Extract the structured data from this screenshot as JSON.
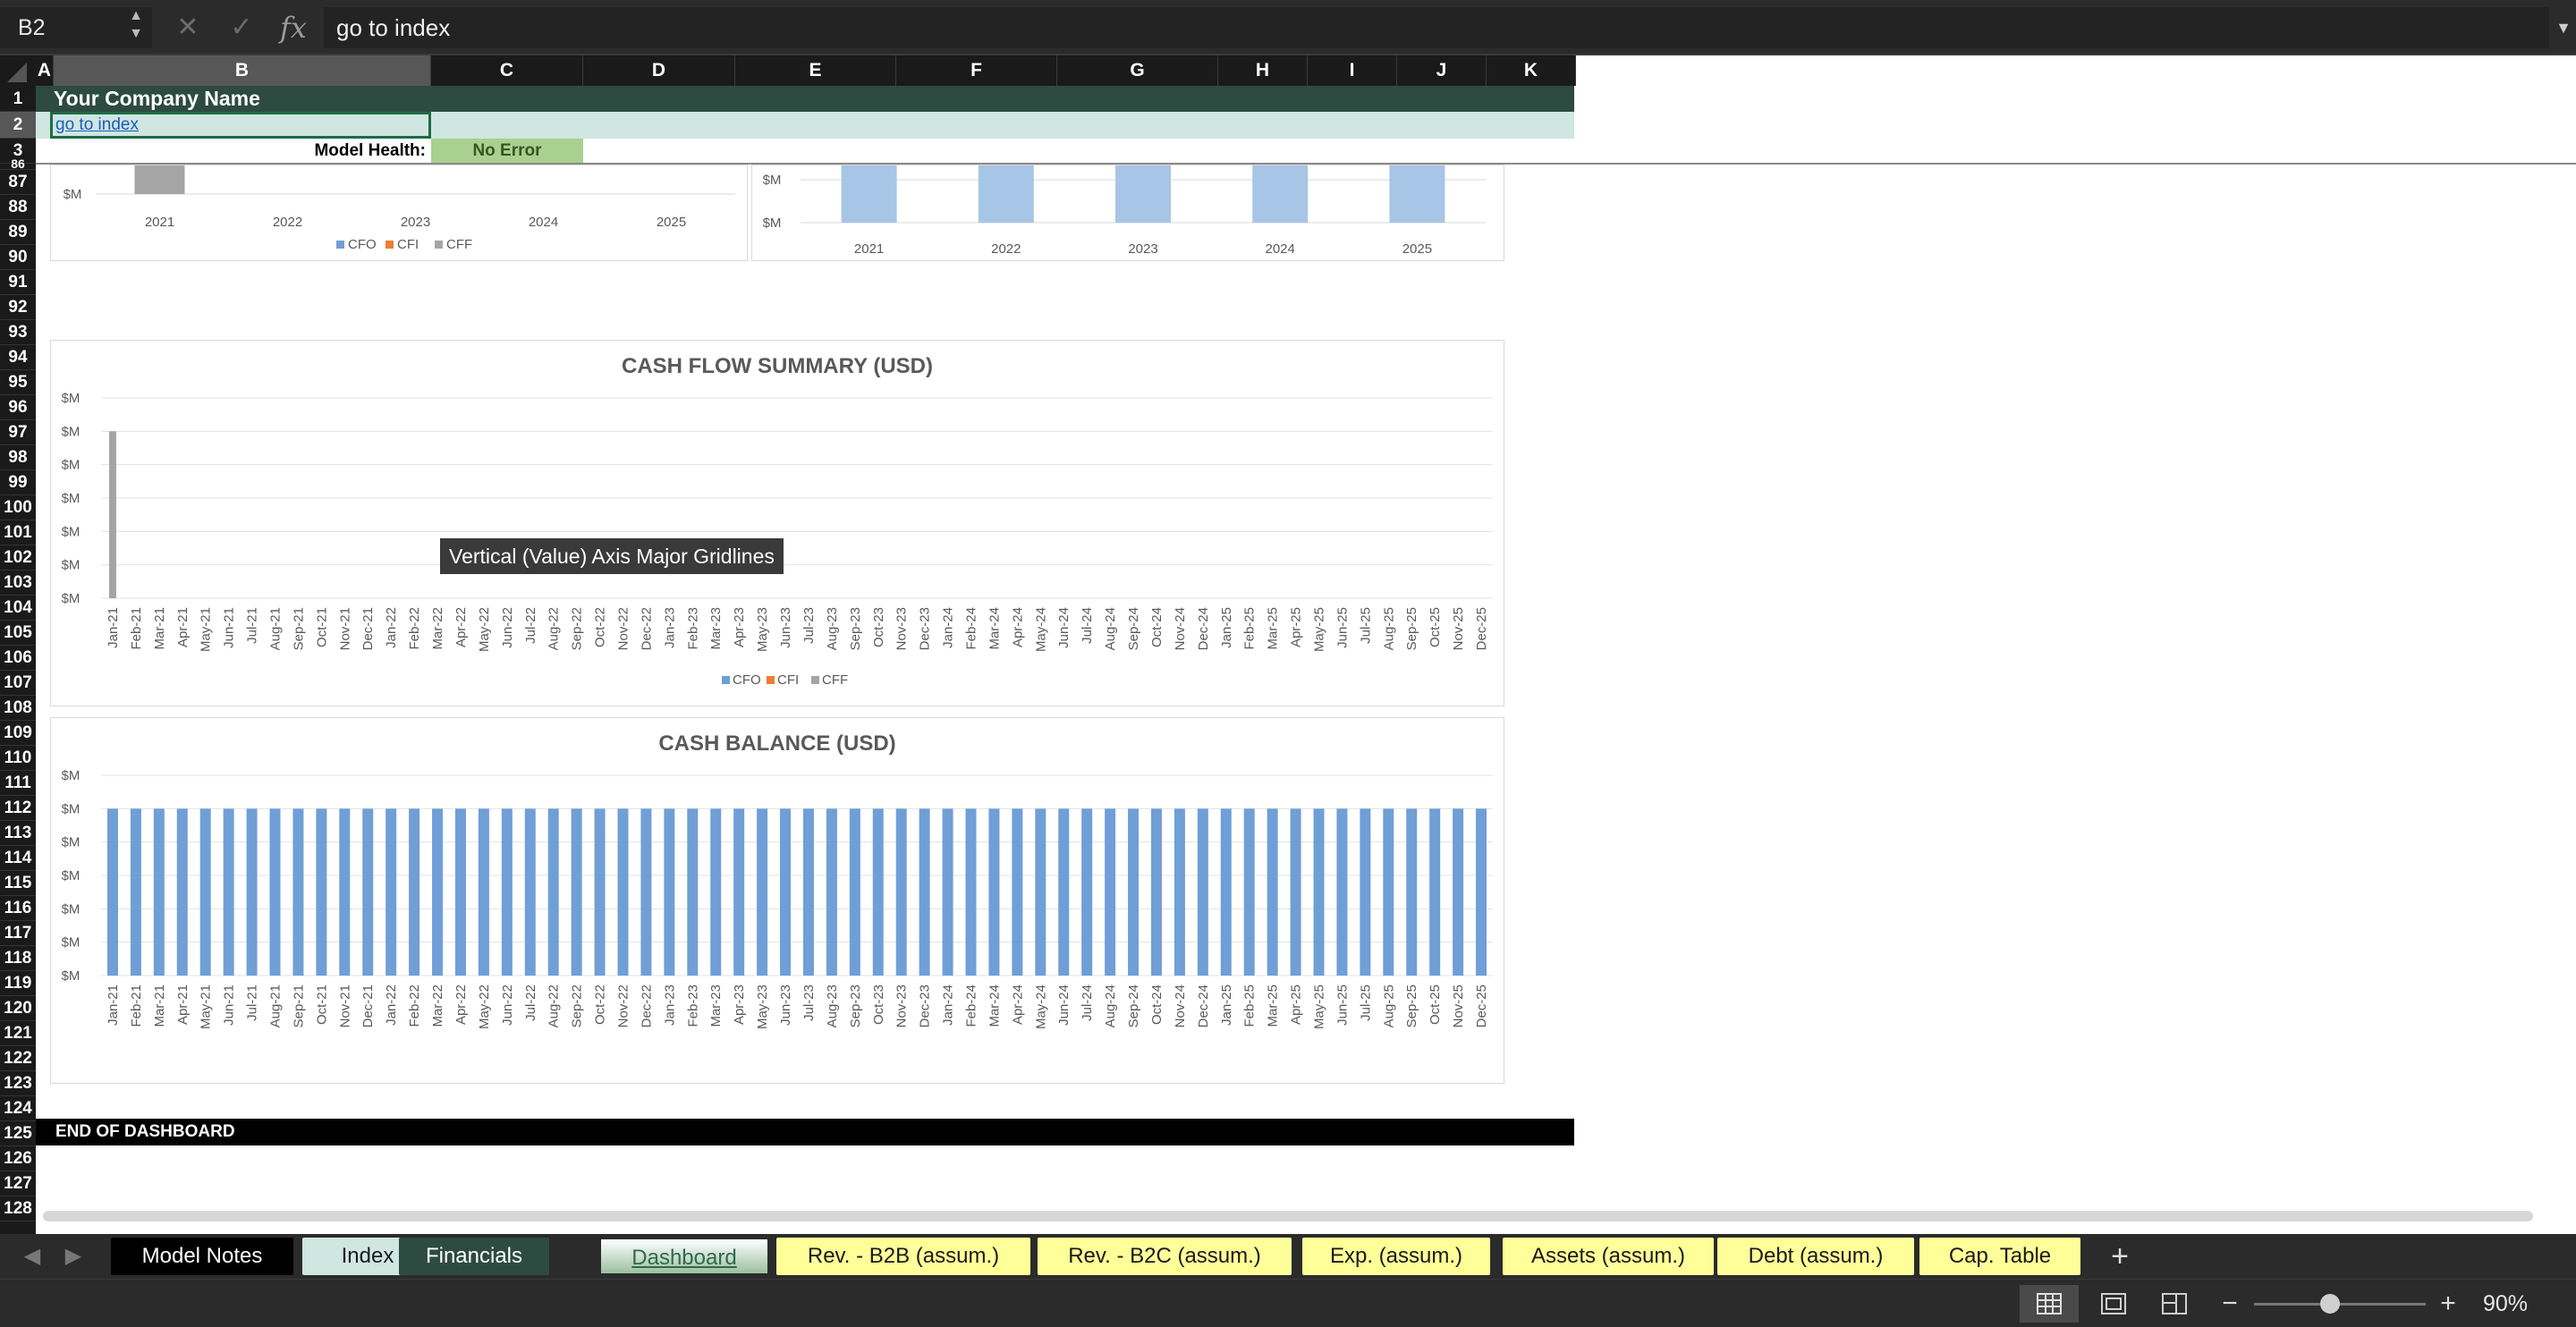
{
  "formula_bar": {
    "cell_ref": "B2",
    "formula": "go to index"
  },
  "columns": [
    "A",
    "B",
    "C",
    "D",
    "E",
    "F",
    "G",
    "H",
    "I",
    "J",
    "K"
  ],
  "selected_column": "B",
  "rows": {
    "frozen": [
      "1",
      "2",
      "3"
    ],
    "scrolled": [
      "86",
      "87",
      "88",
      "89",
      "90",
      "91",
      "92",
      "93",
      "94",
      "95",
      "96",
      "97",
      "98",
      "99",
      "100",
      "101",
      "102",
      "103",
      "104",
      "105",
      "106",
      "107",
      "108",
      "109",
      "110",
      "111",
      "112",
      "113",
      "114",
      "115",
      "116",
      "117",
      "118",
      "119",
      "120",
      "121",
      "122",
      "123",
      "124",
      "125",
      "126",
      "127",
      "128"
    ],
    "selected_row": "2"
  },
  "header": {
    "company_name": "Your Company Name",
    "goto_link": "go to index",
    "health_label": "Model Health:",
    "health_value": "No Error"
  },
  "tooltip": "Vertical (Value) Axis Major Gridlines",
  "end_label": "END OF DASHBOARD",
  "colors": {
    "cfo": "#6f9fd6",
    "cfi": "#ed7d31",
    "cff": "#a5a5a5",
    "header_green": "#2d4b40",
    "row2_tint": "#cfe6e1",
    "health_green": "#a9d08e"
  },
  "chart_data": [
    {
      "type": "bar",
      "note_visible_part": "bottom portion only (scrolled)",
      "categories": [
        "2021",
        "2022",
        "2023",
        "2024",
        "2025"
      ],
      "series": [
        {
          "name": "CFO",
          "values": [
            0,
            0,
            0,
            0,
            0
          ]
        },
        {
          "name": "CFI",
          "values": [
            0,
            0,
            0,
            0,
            0
          ]
        },
        {
          "name": "CFF",
          "values": [
            1,
            0,
            0,
            0,
            0
          ]
        }
      ],
      "y_tick_labels": [
        "$M"
      ],
      "legend": "bottom"
    },
    {
      "type": "bar",
      "note_visible_part": "bottom portion only (scrolled)",
      "categories": [
        "2021",
        "2022",
        "2023",
        "2024",
        "2025"
      ],
      "series": [
        {
          "values": [
            1,
            1,
            1,
            1,
            1
          ]
        }
      ],
      "y_tick_labels": [
        "$M",
        "$M"
      ]
    },
    {
      "type": "bar",
      "title": "CASH FLOW SUMMARY (USD)",
      "categories": [
        "Jan-21",
        "Feb-21",
        "Mar-21",
        "Apr-21",
        "May-21",
        "Jun-21",
        "Jul-21",
        "Aug-21",
        "Sep-21",
        "Oct-21",
        "Nov-21",
        "Dec-21",
        "Jan-22",
        "Feb-22",
        "Mar-22",
        "Apr-22",
        "May-22",
        "Jun-22",
        "Jul-22",
        "Aug-22",
        "Sep-22",
        "Oct-22",
        "Nov-22",
        "Dec-22",
        "Jan-23",
        "Feb-23",
        "Mar-23",
        "Apr-23",
        "May-23",
        "Jun-23",
        "Jul-23",
        "Aug-23",
        "Sep-23",
        "Oct-23",
        "Nov-23",
        "Dec-23",
        "Jan-24",
        "Feb-24",
        "Mar-24",
        "Apr-24",
        "May-24",
        "Jun-24",
        "Jul-24",
        "Aug-24",
        "Sep-24",
        "Oct-24",
        "Nov-24",
        "Dec-24",
        "Jan-25",
        "Feb-25",
        "Mar-25",
        "Apr-25",
        "May-25",
        "Jun-25",
        "Jul-25",
        "Aug-25",
        "Sep-25",
        "Oct-25",
        "Nov-25",
        "Dec-25"
      ],
      "series": [
        {
          "name": "CFO",
          "values": [
            0,
            0,
            0,
            0,
            0,
            0,
            0,
            0,
            0,
            0,
            0,
            0,
            0,
            0,
            0,
            0,
            0,
            0,
            0,
            0,
            0,
            0,
            0,
            0,
            0,
            0,
            0,
            0,
            0,
            0,
            0,
            0,
            0,
            0,
            0,
            0,
            0,
            0,
            0,
            0,
            0,
            0,
            0,
            0,
            0,
            0,
            0,
            0,
            0,
            0,
            0,
            0,
            0,
            0,
            0,
            0,
            0,
            0,
            0,
            0
          ]
        },
        {
          "name": "CFI",
          "values": [
            0,
            0,
            0,
            0,
            0,
            0,
            0,
            0,
            0,
            0,
            0,
            0,
            0,
            0,
            0,
            0,
            0,
            0,
            0,
            0,
            0,
            0,
            0,
            0,
            0,
            0,
            0,
            0,
            0,
            0,
            0,
            0,
            0,
            0,
            0,
            0,
            0,
            0,
            0,
            0,
            0,
            0,
            0,
            0,
            0,
            0,
            0,
            0,
            0,
            0,
            0,
            0,
            0,
            0,
            0,
            0,
            0,
            0,
            0,
            0
          ]
        },
        {
          "name": "CFF",
          "values": [
            5,
            0,
            0,
            0,
            0,
            0,
            0,
            0,
            0,
            0,
            0,
            0,
            0,
            0,
            0,
            0,
            0,
            0,
            0,
            0,
            0,
            0,
            0,
            0,
            0,
            0,
            0,
            0,
            0,
            0,
            0,
            0,
            0,
            0,
            0,
            0,
            0,
            0,
            0,
            0,
            0,
            0,
            0,
            0,
            0,
            0,
            0,
            0,
            0,
            0,
            0,
            0,
            0,
            0,
            0,
            0,
            0,
            0,
            0,
            0
          ]
        }
      ],
      "y_tick_labels": [
        "$M",
        "$M",
        "$M",
        "$M",
        "$M",
        "$M",
        "$M"
      ],
      "ylim": [
        0,
        6
      ],
      "grid": true,
      "legend": "bottom"
    },
    {
      "type": "bar",
      "title": "CASH BALANCE (USD)",
      "categories": [
        "Jan-21",
        "Feb-21",
        "Mar-21",
        "Apr-21",
        "May-21",
        "Jun-21",
        "Jul-21",
        "Aug-21",
        "Sep-21",
        "Oct-21",
        "Nov-21",
        "Dec-21",
        "Jan-22",
        "Feb-22",
        "Mar-22",
        "Apr-22",
        "May-22",
        "Jun-22",
        "Jul-22",
        "Aug-22",
        "Sep-22",
        "Oct-22",
        "Nov-22",
        "Dec-22",
        "Jan-23",
        "Feb-23",
        "Mar-23",
        "Apr-23",
        "May-23",
        "Jun-23",
        "Jul-23",
        "Aug-23",
        "Sep-23",
        "Oct-23",
        "Nov-23",
        "Dec-23",
        "Jan-24",
        "Feb-24",
        "Mar-24",
        "Apr-24",
        "May-24",
        "Jun-24",
        "Jul-24",
        "Aug-24",
        "Sep-24",
        "Oct-24",
        "Nov-24",
        "Dec-24",
        "Jan-25",
        "Feb-25",
        "Mar-25",
        "Apr-25",
        "May-25",
        "Jun-25",
        "Jul-25",
        "Aug-25",
        "Sep-25",
        "Oct-25",
        "Nov-25",
        "Dec-25"
      ],
      "series": [
        {
          "values": [
            5,
            5,
            5,
            5,
            5,
            5,
            5,
            5,
            5,
            5,
            5,
            5,
            5,
            5,
            5,
            5,
            5,
            5,
            5,
            5,
            5,
            5,
            5,
            5,
            5,
            5,
            5,
            5,
            5,
            5,
            5,
            5,
            5,
            5,
            5,
            5,
            5,
            5,
            5,
            5,
            5,
            5,
            5,
            5,
            5,
            5,
            5,
            5,
            5,
            5,
            5,
            5,
            5,
            5,
            5,
            5,
            5,
            5,
            5,
            5
          ]
        }
      ],
      "y_tick_labels": [
        "$M",
        "$M",
        "$M",
        "$M",
        "$M",
        "$M",
        "$M"
      ],
      "ylim": [
        0,
        6
      ],
      "grid": true
    }
  ],
  "tabs": [
    {
      "label": "Model Notes",
      "bg": "#000000",
      "fg": "#ffffff"
    },
    {
      "label": "Index",
      "bg": "#cfe6e1",
      "fg": "#1a1a1a"
    },
    {
      "label": "Financials",
      "bg": "#2d4b40",
      "fg": "#ffffff"
    },
    {
      "label": "Dashboard",
      "bg": "#ffffff",
      "fg": "#2d6a4f",
      "active": true
    },
    {
      "label": "Rev. - B2B (assum.)",
      "bg": "#ffff99",
      "fg": "#1a1a1a"
    },
    {
      "label": "Rev. - B2C (assum.)",
      "bg": "#ffff99",
      "fg": "#1a1a1a"
    },
    {
      "label": "Exp. (assum.)",
      "bg": "#ffff99",
      "fg": "#1a1a1a"
    },
    {
      "label": "Assets (assum.)",
      "bg": "#ffff99",
      "fg": "#1a1a1a"
    },
    {
      "label": "Debt (assum.)",
      "bg": "#ffff99",
      "fg": "#1a1a1a"
    },
    {
      "label": "Cap. Table",
      "bg": "#ffff99",
      "fg": "#1a1a1a"
    }
  ],
  "status": {
    "zoom_level": "90%",
    "zoom_fraction": 0.4,
    "view_modes": [
      "normal-view-icon",
      "page-layout-icon",
      "page-break-icon"
    ]
  }
}
